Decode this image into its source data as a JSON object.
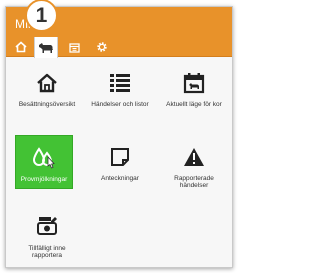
{
  "badge": "1",
  "header": {
    "title": "Min"
  },
  "nav": {
    "items": [
      {
        "icon": "home-icon"
      },
      {
        "icon": "cow-icon"
      },
      {
        "icon": "calendar-icon"
      },
      {
        "icon": "gear-icon"
      }
    ]
  },
  "tiles": [
    {
      "label": "Besättningsöversikt",
      "icon": "house-outline-icon"
    },
    {
      "label": "Händelser och listor",
      "icon": "list-icon"
    },
    {
      "label": "Aktuellt läge för kor",
      "icon": "calendar-cow-icon"
    },
    {
      "label": "Provmjölkningar",
      "icon": "milk-drops-icon",
      "selected": true
    },
    {
      "label": "Anteckningar",
      "icon": "note-icon"
    },
    {
      "label": "Rapporterade händelser",
      "icon": "warning-icon"
    },
    {
      "label": "Tillfälligt inne rapportera",
      "icon": "cow-report-icon"
    }
  ],
  "colors": {
    "accent": "#e8922a",
    "selected": "#43c234"
  }
}
